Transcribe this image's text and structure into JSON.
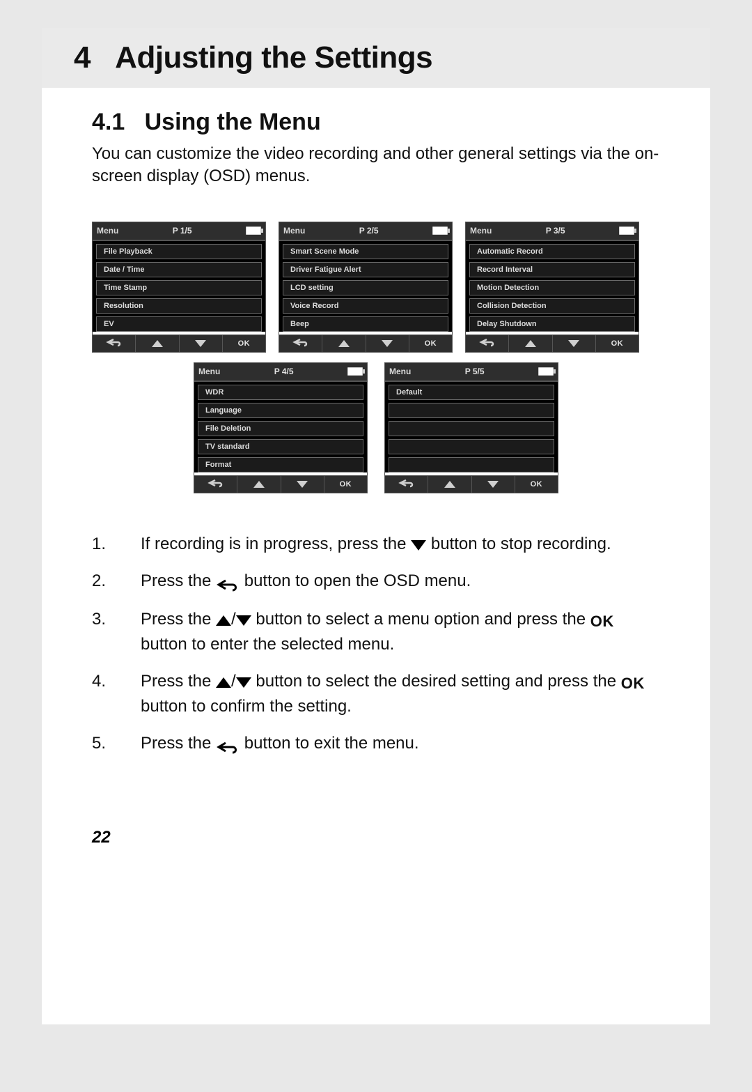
{
  "chapter": {
    "number": "4",
    "title": "Adjusting the Settings"
  },
  "section": {
    "number": "4.1",
    "title": "Using the Menu"
  },
  "intro": "You can customize the video recording and other general settings via the on-screen display (OSD) menus.",
  "osd_label_menu": "Menu",
  "osd_label_ok": "OK",
  "osd_screens": [
    {
      "page": "P 1/5",
      "items": [
        "File Playback",
        "Date / Time",
        "Time Stamp",
        "Resolution",
        "EV"
      ]
    },
    {
      "page": "P 2/5",
      "items": [
        "Smart Scene Mode",
        "Driver Fatigue Alert",
        "LCD setting",
        "Voice Record",
        "Beep"
      ]
    },
    {
      "page": "P 3/5",
      "items": [
        "Automatic Record",
        "Record Interval",
        "Motion Detection",
        "Collision Detection",
        "Delay Shutdown"
      ]
    },
    {
      "page": "P 4/5",
      "items": [
        "WDR",
        "Language",
        "File Deletion",
        "TV standard",
        "Format"
      ]
    },
    {
      "page": "P 5/5",
      "items": [
        "Default",
        "",
        "",
        "",
        ""
      ]
    }
  ],
  "steps": [
    {
      "n": "1.",
      "pre": "If recording is in progress, press the ",
      "icon1": "down",
      "post": " button to stop recording."
    },
    {
      "n": "2.",
      "pre": "Press the ",
      "icon1": "back",
      "post": " button to open the OSD menu."
    },
    {
      "n": "3.",
      "pre": "Press the ",
      "icon1": "updown",
      "mid": " button to select a menu option and press the ",
      "icon2": "ok",
      "post": " button to enter the selected menu."
    },
    {
      "n": "4.",
      "pre": "Press the ",
      "icon1": "updown",
      "mid": " button to select the desired setting and press the ",
      "icon2": "ok",
      "post": " button to confirm the setting."
    },
    {
      "n": "5.",
      "pre": "Press the ",
      "icon1": "back",
      "post": " button to exit the menu."
    }
  ],
  "page_number": "22"
}
